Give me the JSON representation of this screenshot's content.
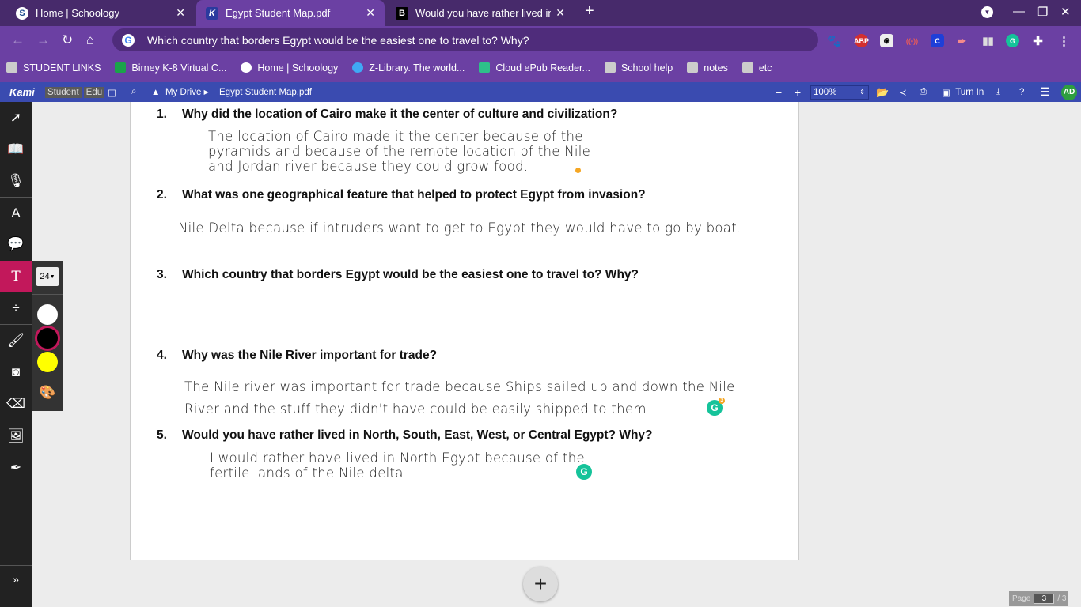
{
  "browser": {
    "tabs": [
      {
        "label": "Home | Schoology",
        "icon": "S",
        "active": false
      },
      {
        "label": "Egypt Student Map.pdf",
        "icon": "K",
        "active": true
      },
      {
        "label": "Would you have rather lived in N",
        "icon": "B",
        "active": false
      }
    ],
    "address": "Which country that borders Egypt would be the easiest one to travel to?  Why?",
    "bookmarks": [
      "STUDENT LINKS",
      "Birney K-8 Virtual C...",
      "Home | Schoology",
      "Z-Library. The world...",
      "Cloud ePub Reader...",
      "School help",
      "notes",
      "etc"
    ],
    "extensions": {
      "abp": "ABP",
      "c": "C"
    }
  },
  "kami": {
    "logo": "Kami",
    "badge_student": "Student",
    "badge_edu": "Edu",
    "breadcrumb_drive": "My Drive",
    "file_name": "Egypt Student Map.pdf",
    "zoom": "100%",
    "turn_in": "Turn In",
    "avatar": "AD",
    "font_size": "24",
    "colors": [
      "#ffffff",
      "#000000",
      "#ffff00"
    ],
    "accent": "#c2185b"
  },
  "document": {
    "questions": [
      {
        "num": "1.",
        "text": "Why did the location of Cairo make it the center of culture and civilization?"
      },
      {
        "num": "2.",
        "text": "What was one geographical feature that helped to protect Egypt from invasion?"
      },
      {
        "num": "3.",
        "text": "Which country that borders Egypt would be the easiest one to travel to?  Why?"
      },
      {
        "num": "4.",
        "text": "Why was the Nile River important for trade?"
      },
      {
        "num": "5.",
        "text": "Would you have rather lived in North, South, East, West, or Central Egypt?  Why?"
      }
    ],
    "answers": {
      "a1": [
        "The location of Cairo made it the center because of the",
        "pyramids and because of the remote location of the Nile",
        "and Jordan river because they could grow food."
      ],
      "a2": [
        "Nile Delta because if intruders want to get to Egypt they would have to go by boat."
      ],
      "a4": [
        "The Nile river was important for trade because Ships sailed up and down the Nile",
        "River and the stuff they didn't have could be easily shipped to them"
      ],
      "a5": [
        "I would rather have lived in North Egypt because of the",
        "fertile lands of the Nile delta"
      ]
    },
    "grammarly_count": "3"
  },
  "pager": {
    "label": "Page",
    "current": "3",
    "total": "/ 3"
  }
}
